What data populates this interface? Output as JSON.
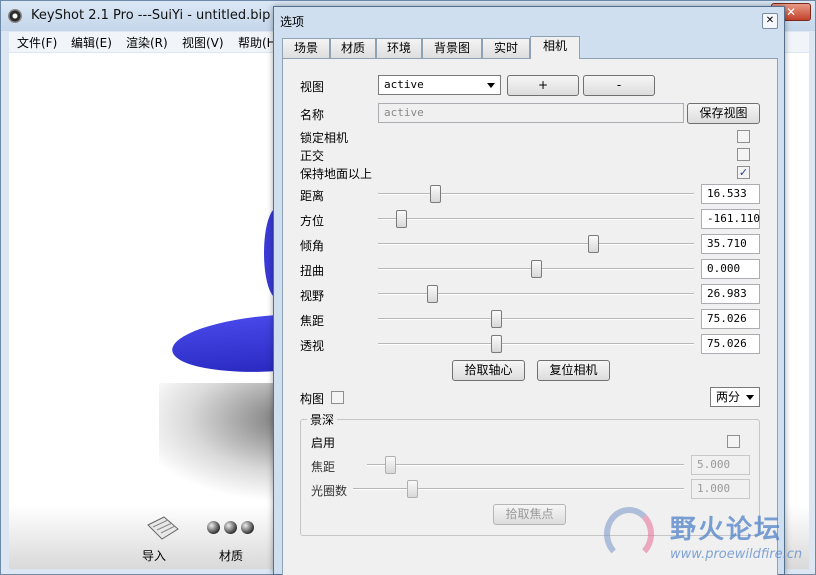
{
  "main_window": {
    "title": "KeyShot 2.1 Pro ---SuiYi - untitled.bip",
    "close_glyph": "✕",
    "menu": [
      "文件(F)",
      "编辑(E)",
      "渲染(R)",
      "视图(V)",
      "帮助(H"
    ],
    "bottom": {
      "import_label": "导入",
      "material_label": "材质"
    }
  },
  "dialog": {
    "title": "选项",
    "close_glyph": "✕",
    "tabs": [
      "场景",
      "材质",
      "环境",
      "背景图",
      "实时",
      "相机"
    ],
    "active_tab": "相机",
    "camera": {
      "view_label": "视图",
      "view_value": "active",
      "add_button": "+",
      "remove_button": "-",
      "name_label": "名称",
      "name_value": "active",
      "save_view_button": "保存视图",
      "lock_camera_label": "锁定相机",
      "lock_camera_checked": false,
      "orthographic_label": "正交",
      "orthographic_checked": false,
      "keep_above_ground_label": "保持地面以上",
      "keep_above_ground_checked": true,
      "check_glyph": "✓",
      "sliders": [
        {
          "label": "距离",
          "value": "16.533",
          "position": 0.17
        },
        {
          "label": "方位",
          "value": "-161.110",
          "position": 0.06
        },
        {
          "label": "倾角",
          "value": "35.710",
          "position": 0.69
        },
        {
          "label": "扭曲",
          "value": "0.000",
          "position": 0.5
        },
        {
          "label": "视野",
          "value": "26.983",
          "position": 0.16
        },
        {
          "label": "焦距",
          "value": "75.026",
          "position": 0.37
        },
        {
          "label": "透视",
          "value": "75.026",
          "position": 0.37
        }
      ],
      "pick_axis_button": "拾取轴心",
      "reset_camera_button": "复位相机",
      "composition_label": "构图",
      "composition_checked": false,
      "composition_mode": "两分",
      "dof": {
        "title": "景深",
        "enable_label": "启用",
        "enable_checked": false,
        "focal_label": "焦距",
        "focal_value": "5.000",
        "focal_position": 0.06,
        "aperture_label": "光圈数",
        "aperture_value": "1.000",
        "aperture_position": 0.17,
        "pick_focus_button": "拾取焦点"
      }
    }
  },
  "watermark": {
    "text": "野火论坛",
    "url": "www.proewildfire.cn"
  }
}
